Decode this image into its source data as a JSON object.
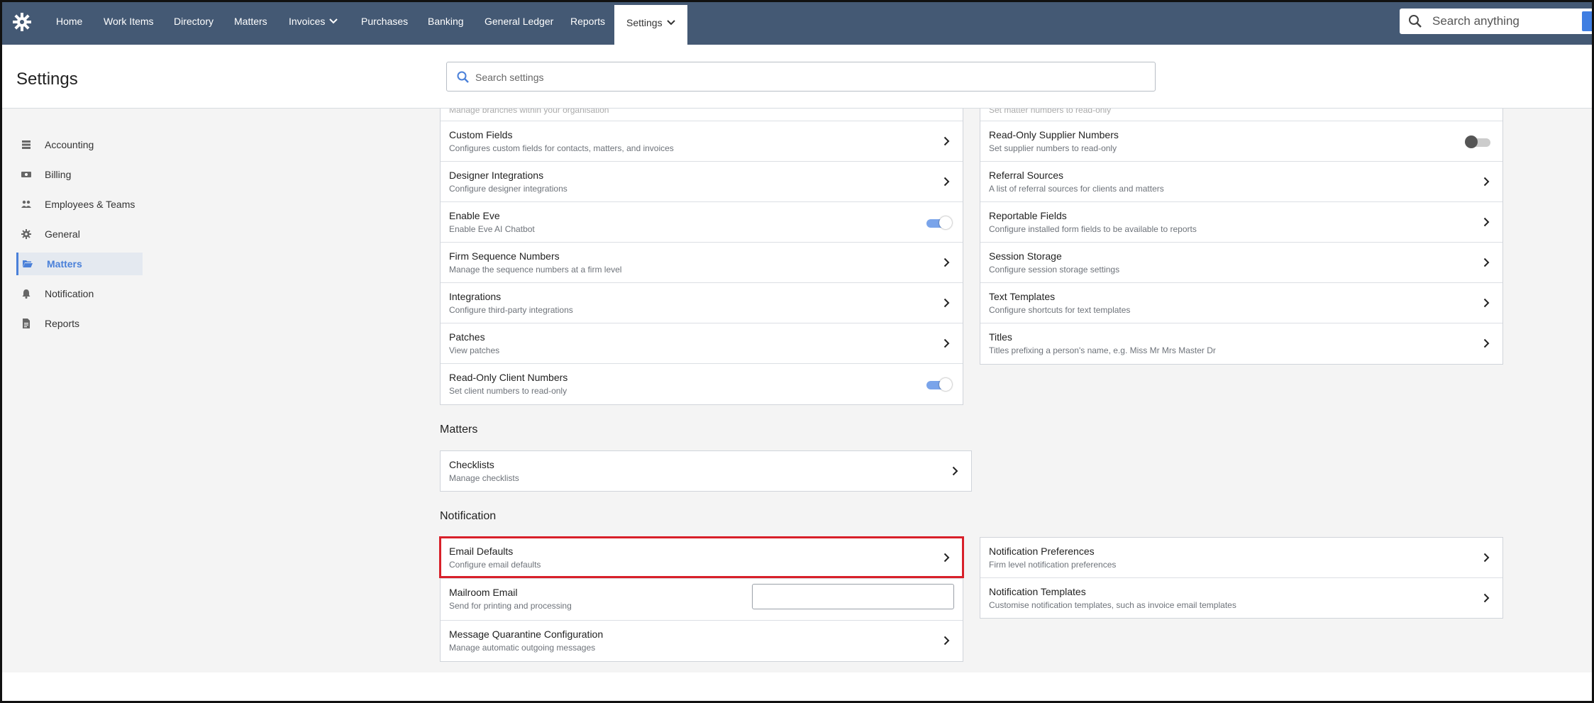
{
  "nav": {
    "items": [
      "Home",
      "Work Items",
      "Directory",
      "Matters",
      "Invoices",
      "Purchases",
      "Banking",
      "General Ledger",
      "Reports",
      "Settings"
    ],
    "search_placeholder": "Search anything"
  },
  "header": {
    "title": "Settings",
    "search_placeholder": "Search settings"
  },
  "sidebar": {
    "items": [
      {
        "label": "Accounting",
        "icon": "accounting-icon"
      },
      {
        "label": "Billing",
        "icon": "billing-icon"
      },
      {
        "label": "Employees & Teams",
        "icon": "team-icon"
      },
      {
        "label": "General",
        "icon": "gear-icon"
      },
      {
        "label": "Matters",
        "icon": "folder-open-icon"
      },
      {
        "label": "Notification",
        "icon": "bell-icon"
      },
      {
        "label": "Reports",
        "icon": "document-icon"
      }
    ],
    "active": "Matters"
  },
  "general_left": [
    {
      "title": "Custom Fields",
      "subtitle": "Configures custom fields for contacts, matters, and invoices",
      "control": "arrow"
    },
    {
      "title": "Designer Integrations",
      "subtitle": "Configure designer integrations",
      "control": "arrow"
    },
    {
      "title": "Enable Eve",
      "subtitle": "Enable Eve AI Chatbot",
      "control": "toggle-on"
    },
    {
      "title": "Firm Sequence Numbers",
      "subtitle": "Manage the sequence numbers at a firm level",
      "control": "arrow"
    },
    {
      "title": "Integrations",
      "subtitle": "Configure third-party integrations",
      "control": "arrow"
    },
    {
      "title": "Patches",
      "subtitle": "View patches",
      "control": "arrow"
    },
    {
      "title": "Read-Only Client Numbers",
      "subtitle": "Set client numbers to read-only",
      "control": "toggle-on"
    }
  ],
  "general_right": [
    {
      "title": "Read-Only Supplier Numbers",
      "subtitle": "Set supplier numbers to read-only",
      "control": "toggle-off"
    },
    {
      "title": "Referral Sources",
      "subtitle": "A list of referral sources for clients and matters",
      "control": "arrow"
    },
    {
      "title": "Reportable Fields",
      "subtitle": "Configure installed form fields to be available to reports",
      "control": "arrow"
    },
    {
      "title": "Session Storage",
      "subtitle": "Configure session storage settings",
      "control": "arrow"
    },
    {
      "title": "Text Templates",
      "subtitle": "Configure shortcuts for text templates",
      "control": "arrow"
    },
    {
      "title": "Titles",
      "subtitle": "Titles prefixing a person's name, e.g. Miss Mr Mrs Master Dr",
      "control": "arrow"
    }
  ],
  "matters_section": {
    "title": "Matters",
    "items": [
      {
        "title": "Checklists",
        "subtitle": "Manage checklists",
        "control": "arrow"
      }
    ]
  },
  "notification_section": {
    "title": "Notification",
    "left": [
      {
        "title": "Email Defaults",
        "subtitle": "Configure email defaults",
        "control": "arrow",
        "highlighted": true
      },
      {
        "title": "Mailroom Email",
        "subtitle": "Send for printing and processing",
        "control": "input",
        "value": ""
      },
      {
        "title": "Message Quarantine Configuration",
        "subtitle": "Manage automatic outgoing messages",
        "control": "arrow"
      }
    ],
    "right": [
      {
        "title": "Notification Preferences",
        "subtitle": "Firm level notification preferences",
        "control": "arrow"
      },
      {
        "title": "Notification Templates",
        "subtitle": "Customise notification templates, such as invoice email templates",
        "control": "arrow"
      }
    ]
  },
  "colors": {
    "nav_bg": "#445974",
    "accent": "#4a80d9",
    "highlight": "#d8202a"
  }
}
